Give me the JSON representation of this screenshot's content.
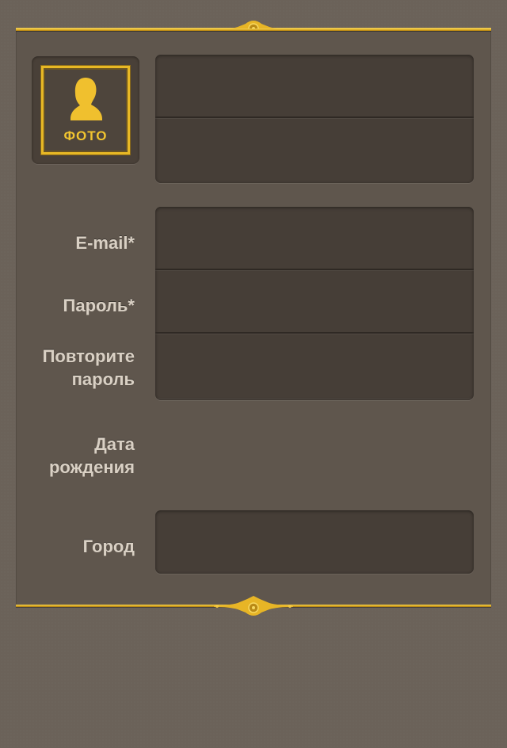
{
  "photo": {
    "label": "ФОТО",
    "icon": "person-silhouette-icon"
  },
  "name_fields": [
    {
      "value": "",
      "placeholder": ""
    },
    {
      "value": "",
      "placeholder": ""
    }
  ],
  "account_fields": [
    {
      "label": "E-mail*",
      "value": "",
      "placeholder": ""
    },
    {
      "label": "Пароль*",
      "value": "",
      "placeholder": ""
    },
    {
      "label": "Повторите\nпароль",
      "value": "",
      "placeholder": ""
    }
  ],
  "birthdate": {
    "label": "Дата\nрождения"
  },
  "city": {
    "label": "Город",
    "value": "",
    "placeholder": ""
  },
  "colors": {
    "background": "#6b6259",
    "panel": "#5f564d",
    "field": "#463e37",
    "gold": "#e8b825",
    "label_text": "#d9d0c4"
  }
}
